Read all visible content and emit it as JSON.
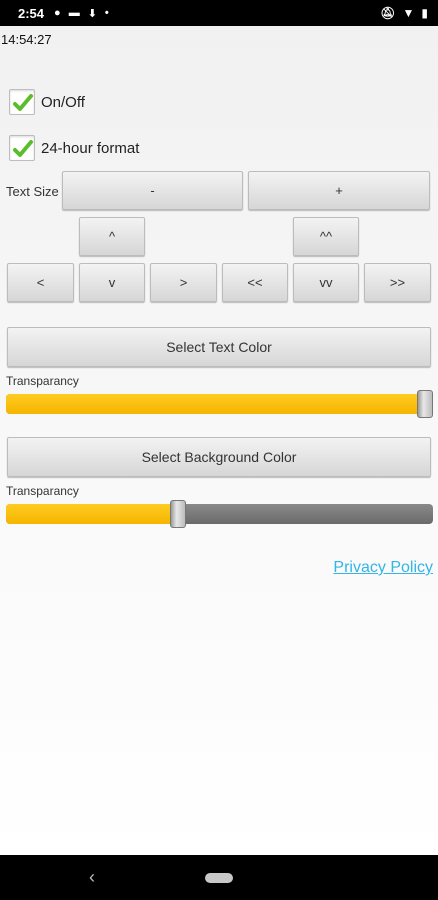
{
  "status_bar": {
    "time": "2:54",
    "icons_left": [
      "p-icon",
      "image-icon",
      "download-icon",
      "dot-icon"
    ],
    "icons_right": [
      "notifications-off-icon",
      "wifi-icon",
      "battery-icon"
    ]
  },
  "clock": {
    "text": "14:54:27"
  },
  "checkboxes": [
    {
      "label": "On/Off",
      "checked": true
    },
    {
      "label": "24-hour format",
      "checked": true
    }
  ],
  "text_size": {
    "label": "Text Size",
    "minus": "-",
    "plus": "+"
  },
  "position_buttons": {
    "up": "^",
    "up_fast": "^^",
    "left": "<",
    "down": "v",
    "right": ">",
    "left_fast": "<<",
    "down_fast": "vv",
    "right_fast": ">>"
  },
  "text_color": {
    "button": "Select Text Color",
    "transparency_label": "Transparancy",
    "transparency_value": 1.0
  },
  "background_color": {
    "button": "Select Background Color",
    "transparency_label": "Transparancy",
    "transparency_value": 0.4
  },
  "privacy": {
    "label": "Privacy Policy"
  },
  "colors": {
    "accent": "#f5b500",
    "link": "#33b5e5",
    "check": "#5bbd2b"
  }
}
